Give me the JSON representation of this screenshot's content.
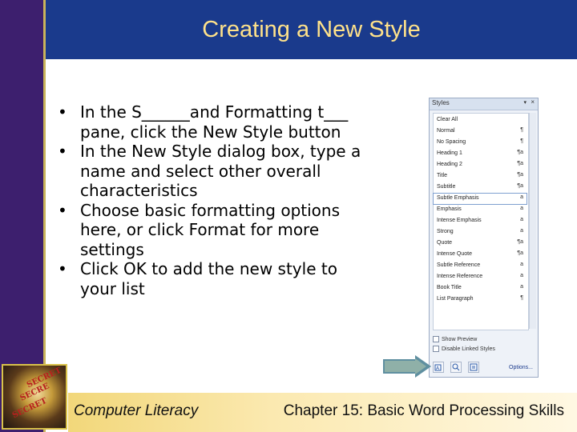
{
  "slide": {
    "title": "Creating a New Style",
    "bullets": [
      "In the S______and Formatting t___ pane, click the New Style button",
      "In the New Style dialog box, type a name and select other overall characteristics",
      "Choose basic formatting options here, or click Format for more settings",
      "Click OK to add the new style to your list"
    ]
  },
  "styles_pane": {
    "title": "Styles",
    "menu_glyph": "▾",
    "close_glyph": "×",
    "items": [
      {
        "name": "Clear All",
        "marker": ""
      },
      {
        "name": "Normal",
        "marker": "¶"
      },
      {
        "name": "No Spacing",
        "marker": "¶"
      },
      {
        "name": "Heading 1",
        "marker": "¶a"
      },
      {
        "name": "Heading 2",
        "marker": "¶a"
      },
      {
        "name": "Title",
        "marker": "¶a"
      },
      {
        "name": "Subtitle",
        "marker": "¶a"
      },
      {
        "name": "Subtle Emphasis",
        "marker": "a",
        "selected": true
      },
      {
        "name": "Emphasis",
        "marker": "a"
      },
      {
        "name": "Intense Emphasis",
        "marker": "a"
      },
      {
        "name": "Strong",
        "marker": "a"
      },
      {
        "name": "Quote",
        "marker": "¶a"
      },
      {
        "name": "Intense Quote",
        "marker": "¶a"
      },
      {
        "name": "Subtle Reference",
        "marker": "a"
      },
      {
        "name": "Intense Reference",
        "marker": "a"
      },
      {
        "name": "Book Title",
        "marker": "a"
      },
      {
        "name": "List Paragraph",
        "marker": "¶"
      }
    ],
    "show_preview": "Show Preview",
    "disable_linked": "Disable Linked Styles",
    "buttons": [
      "new-style",
      "style-inspector",
      "manage-styles"
    ],
    "options_label": "Options..."
  },
  "footer": {
    "left": "Computer Literacy",
    "right": "Chapter 15: Basic Word Processing Skills"
  },
  "logo": {
    "words": [
      "SECRET",
      "SECRE",
      "SECRET"
    ]
  },
  "colors": {
    "title_bg": "#1a3a8c",
    "title_text": "#ffe28a",
    "left_bar": "#3d1f6e",
    "footer_bg": "#f2d77a"
  }
}
